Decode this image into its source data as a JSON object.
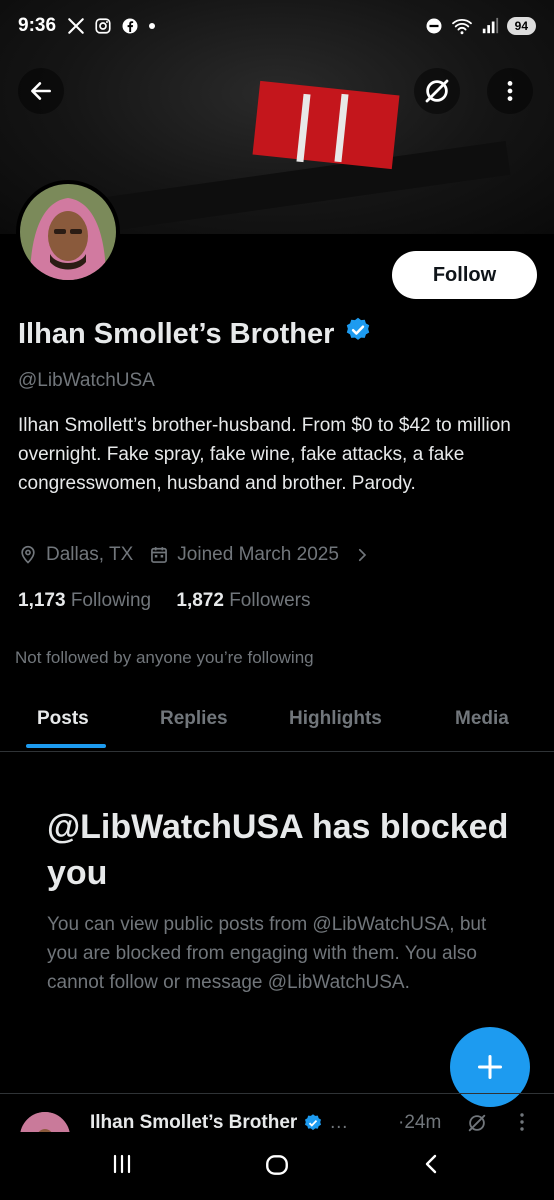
{
  "status_bar": {
    "time": "9:36",
    "battery": "94",
    "icons": [
      "x-logo-icon",
      "instagram-icon",
      "facebook-icon",
      "dot-icon",
      "dnd-icon",
      "wifi-icon",
      "signal-icon",
      "battery-icon"
    ]
  },
  "header": {
    "back_icon": "arrow-left-icon",
    "grok_icon": "grok-icon",
    "more_icon": "more-vertical-icon"
  },
  "profile": {
    "name": "Ilhan Smollet’s Brother",
    "verified": true,
    "handle": "@LibWatchUSA",
    "bio": "Ilhan Smollett’s brother-husband. From $0 to $42 to million overnight. Fake spray, fake wine, fake attacks, a fake congresswomen, husband and brother. Parody.",
    "location": "Dallas, TX",
    "joined": "Joined March 2025",
    "following_count": "1,173",
    "following_label": "Following",
    "followers_count": "1,872",
    "followers_label": "Followers",
    "not_followed": "Not followed by anyone you’re following",
    "follow_label": "Follow"
  },
  "tabs": [
    {
      "label": "Posts",
      "active": true
    },
    {
      "label": "Replies",
      "active": false
    },
    {
      "label": "Highlights",
      "active": false
    },
    {
      "label": "Media",
      "active": false
    }
  ],
  "blocked": {
    "title": "@LibWatchUSA has blocked you",
    "body": "You can view public posts from @LibWatchUSA, but you are blocked from engaging with them. You also cannot follow or message @LibWatchUSA."
  },
  "post_preview": {
    "name": "Ilhan Smollet’s Brother",
    "ellipsis": "…",
    "time": "·24m"
  },
  "colors": {
    "accent": "#1d9bf0",
    "background": "#000000",
    "text_primary": "#e7e9ea",
    "text_secondary": "#71767b",
    "border": "#2f3336"
  },
  "nav": {
    "icons": [
      "recents-icon",
      "home-icon",
      "back-icon"
    ]
  }
}
